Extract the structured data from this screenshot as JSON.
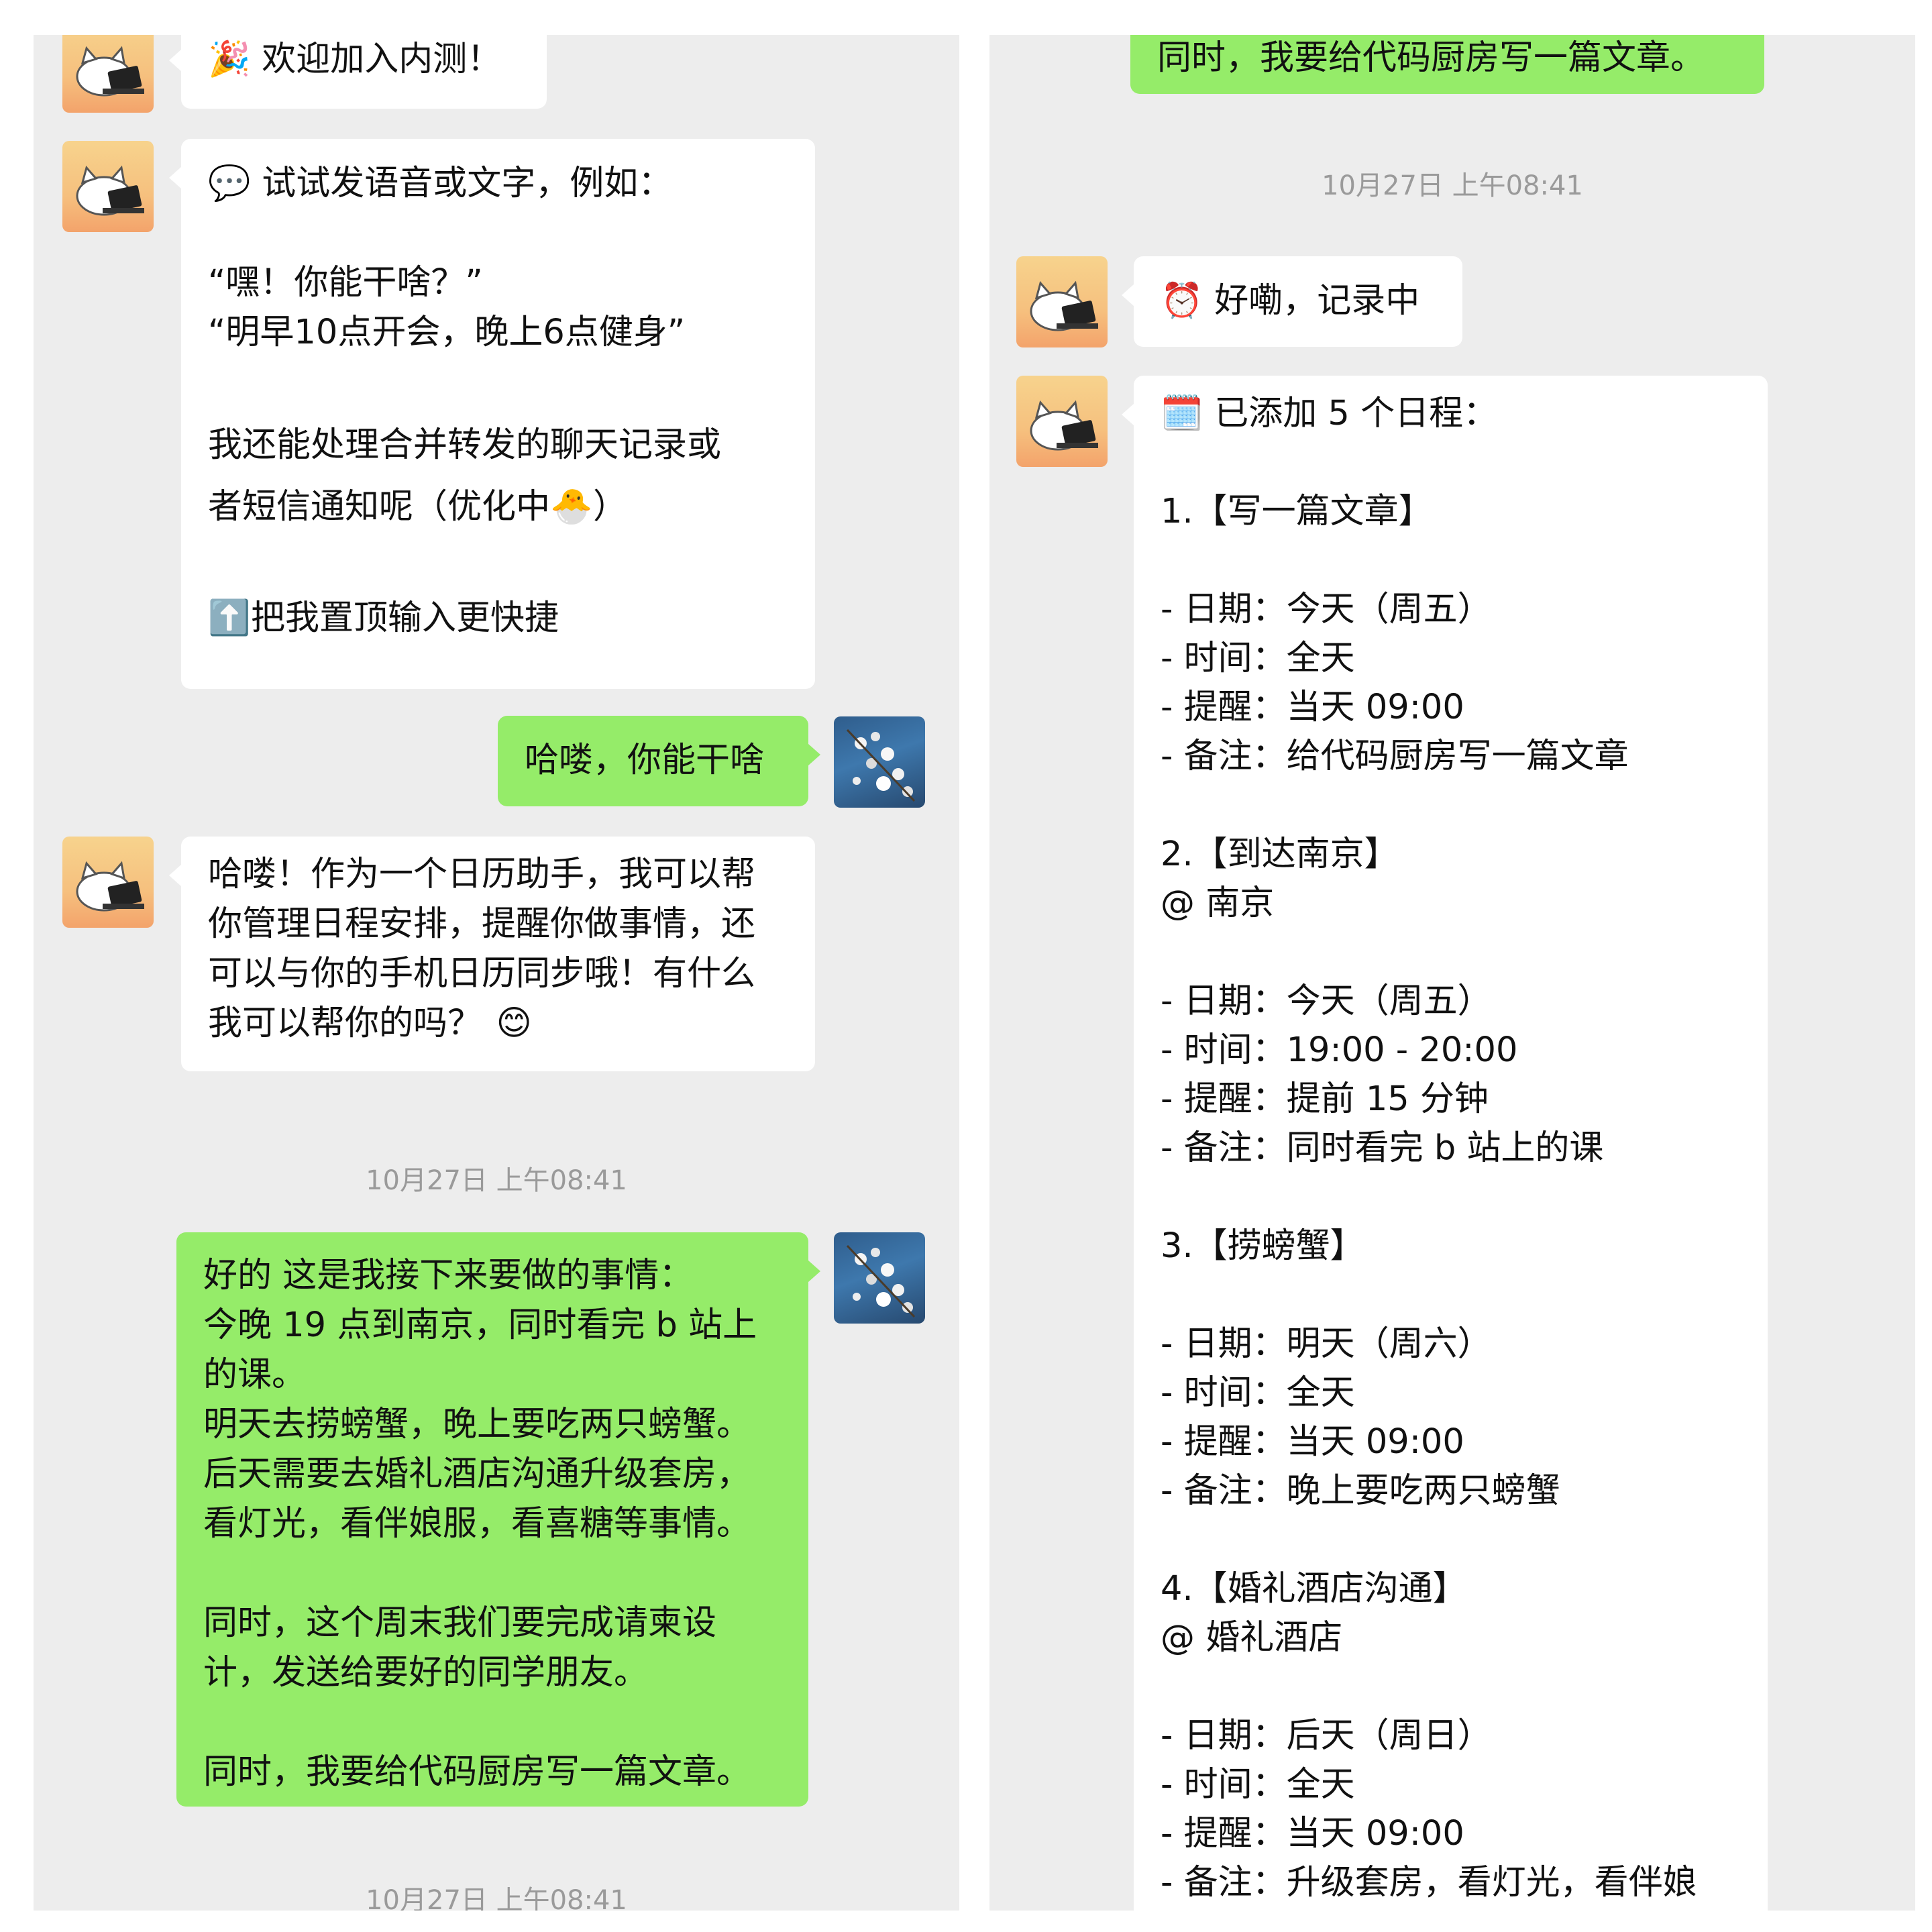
{
  "left": {
    "welcome": {
      "emoji": "🎉",
      "text": "欢迎加入内测！"
    },
    "tips": {
      "emoji": "💬",
      "header": "试试发语音或文字，例如：",
      "examples": [
        "“嘿！你能干啥？”",
        "“明早10点开会，晚上6点健身”"
      ],
      "more_lines": [
        "我还能处理合并转发的聊天记录或",
        "者短信通知呢（优化中"
      ],
      "more_emoji": "🐣",
      "more_close": "）",
      "pin_emoji": "⬆️",
      "pin_text": "把我置顶输入更快捷"
    },
    "user_msg_1": "哈喽，你能干啥",
    "bot_reply": {
      "lines": [
        "哈喽！作为一个日历助手，我可以帮",
        "你管理日程安排，提醒你做事情，还",
        "可以与你的手机日历同步哦！有什么",
        "我可以帮你的吗？"
      ],
      "emoji": "😊"
    },
    "timestamp_1": "10月27日 上午08:41",
    "user_msg_2": {
      "paragraphs": [
        [
          "好的 这是我接下来要做的事情：",
          "今晚 19 点到南京，同时看完 b 站上",
          "的课。",
          "明天去捞螃蟹，晚上要吃两只螃蟹。",
          "后天需要去婚礼酒店沟通升级套房，",
          "看灯光，看伴娘服，看喜糖等事情。"
        ],
        [
          "同时，这个周末我们要完成请柬设",
          "计，发送给要好的同学朋友。"
        ],
        [
          "同时，我要给代码厨房写一篇文章。"
        ]
      ]
    },
    "timestamp_2": "10月27日 上午08:41"
  },
  "right": {
    "user_msg_tail": "同时，我要给代码厨房写一篇文章。",
    "timestamp": "10月27日 上午08:41",
    "ack": {
      "emoji": "⏰",
      "text": "好嘞，记录中"
    },
    "schedule": {
      "emoji": "🗓️",
      "header": "已添加 5 个日程：",
      "items": [
        {
          "title": "1.【写一篇文章】",
          "location": "",
          "lines": [
            "- 日期：今天（周五）",
            "- 时间：全天",
            "- 提醒：当天 09:00",
            "- 备注：给代码厨房写一篇文章"
          ]
        },
        {
          "title": "2.【到达南京】",
          "location": "@ 南京",
          "lines": [
            "- 日期：今天（周五）",
            "- 时间：19:00 - 20:00",
            "- 提醒：提前 15 分钟",
            "- 备注：同时看完 b 站上的课"
          ]
        },
        {
          "title": "3.【捞螃蟹】",
          "location": "",
          "lines": [
            "- 日期：明天（周六）",
            "- 时间：全天",
            "- 提醒：当天 09:00",
            "- 备注：晚上要吃两只螃蟹"
          ]
        },
        {
          "title": "4.【婚礼酒店沟通】",
          "location": "@ 婚礼酒店",
          "lines": [
            "- 日期：后天（周日）",
            "- 时间：全天",
            "- 提醒：当天 09:00",
            "- 备注：升级套房，看灯光，看伴娘"
          ]
        }
      ]
    }
  }
}
